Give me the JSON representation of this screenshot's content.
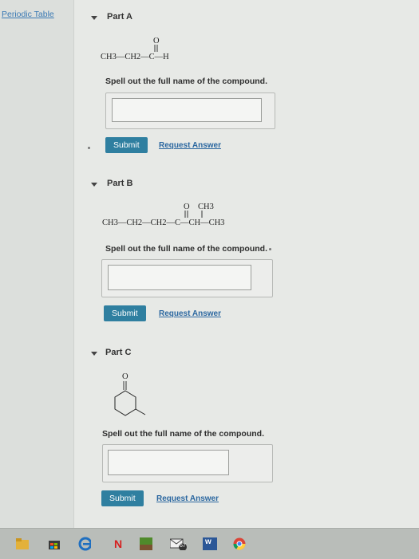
{
  "sidebar": {
    "periodic_table_label": "Periodic Table"
  },
  "parts": [
    {
      "title": "Part A",
      "formula": {
        "main": "CH3—CH2—C—H",
        "carbonyl_o": "O"
      },
      "prompt": "Spell out the full name of the compound.",
      "answer_value": "",
      "submit_label": "Submit",
      "request_label": "Request Answer"
    },
    {
      "title": "Part B",
      "formula": {
        "main": "CH3—CH2—CH2—C—CH—CH3",
        "carbonyl_o": "O",
        "branch": "CH3"
      },
      "prompt": "Spell out the full name of the compound.",
      "answer_value": "",
      "submit_label": "Submit",
      "request_label": "Request Answer"
    },
    {
      "title": "Part C",
      "formula": {
        "carbonyl_o": "O"
      },
      "prompt": "Spell out the full name of the compound.",
      "answer_value": "",
      "submit_label": "Submit",
      "request_label": "Request Answer"
    }
  ],
  "taskbar": {
    "icons": [
      "file-explorer-icon",
      "store-icon",
      "edge-icon",
      "netflix-icon",
      "minecraft-icon",
      "mail-icon",
      "word-icon",
      "chrome-icon"
    ],
    "badge": "67",
    "netflix_letter": "N",
    "word_label": "w"
  },
  "colors": {
    "accent": "#2f7fa0",
    "link": "#2b67a0",
    "background": "#e7e9e6"
  }
}
